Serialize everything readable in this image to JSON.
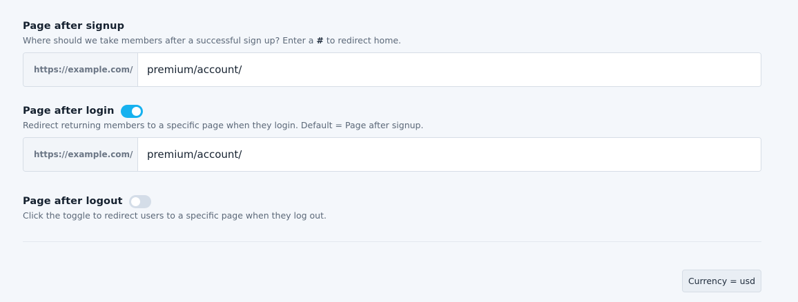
{
  "signup": {
    "title": "Page after signup",
    "description_before": "Where should we take members after a successful sign up? Enter a ",
    "description_symbol": "#",
    "description_after": " to redirect home.",
    "prefix": "https://example.com/",
    "value": "premium/account/"
  },
  "login": {
    "title": "Page after login",
    "toggle_on": true,
    "description": "Redirect returning members to a specific page when they login. Default = Page after signup.",
    "prefix": "https://example.com/",
    "value": "premium/account/"
  },
  "logout": {
    "title": "Page after logout",
    "toggle_on": false,
    "description": "Click the toggle to redirect users to a specific page when they log out."
  },
  "footer": {
    "currency_badge": "Currency = usd"
  },
  "colors": {
    "toggle_on": "#16b1ef",
    "toggle_off": "#d4dde8",
    "background": "#f4f7fb"
  }
}
